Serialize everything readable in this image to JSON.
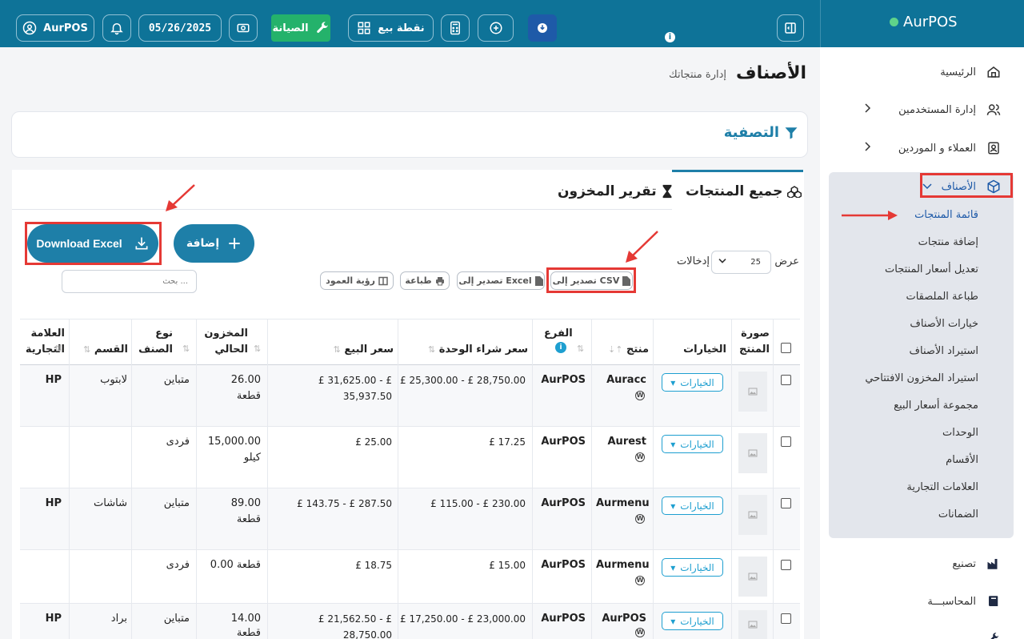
{
  "topbar": {
    "user_label": "AurPOS",
    "date": "05/26/2025",
    "maintenance_label": "الصيانة",
    "pos_label": "نقطة بيع"
  },
  "brand": {
    "name": "AurPOS"
  },
  "sidebar": {
    "items": [
      {
        "label": "الرئيسية",
        "icon": "home-icon"
      },
      {
        "label": "إدارة المستخدمين",
        "icon": "users-icon"
      },
      {
        "label": "العملاء و الموردين",
        "icon": "contacts-icon"
      },
      {
        "label": "الأصناف",
        "icon": "cube-icon"
      },
      {
        "label": "تصنيع",
        "icon": "factory-icon"
      },
      {
        "label": "المحاسبـــة",
        "icon": "book-icon"
      }
    ],
    "sub_items": [
      "قائمة المنتجات",
      "إضافة منتجات",
      "تعديل أسعار المنتجات",
      "طباعة الملصقات",
      "خيارات الأصناف",
      "استيراد الأصناف",
      "استيراد المخزون الافتتاحي",
      "مجموعة أسعار البيع",
      "الوحدات",
      "الأقسام",
      "العلامات التجارية",
      "الضمانات"
    ]
  },
  "page": {
    "title": "الأصناف",
    "subtitle": "إدارة منتجاتك"
  },
  "filter": {
    "label": "التصفية"
  },
  "tabs": {
    "all_products": "جميع المنتجات",
    "stock_report": "تقرير المخزون"
  },
  "actions": {
    "add": "إضافة",
    "download_excel": "Download Excel",
    "export_csv": "تصدير إلى CSV",
    "export_excel": "تصدير إلى Excel",
    "print": "طباعة",
    "column_visibility": "رؤية العمود",
    "search_placeholder": "بحث ...",
    "show": "عرض",
    "entries": "إدخالات",
    "page_size": "25"
  },
  "table": {
    "headers": {
      "image": "صورة المنتج",
      "options": "الخيارات",
      "product": "منتج",
      "branch": "الفرع",
      "purchase_price": "سعر شراء الوحدة",
      "selling_price": "سعر البيع",
      "stock": "المخزون الحالي",
      "type": "نوع الصنف",
      "category": "القسم",
      "brand": "العلامة التجارية"
    },
    "options_button": "الخيارات",
    "rows": [
      {
        "product": "Auracc",
        "branch": "AurPOS",
        "purchase": "£ 25,300.00 - £ 28,750.00",
        "selling": "£ 31,625.00 - £ 35,937.50",
        "stock": "26.00",
        "unit": "قطعة",
        "type": "متباين",
        "category": "لابتوب",
        "brand": "HP"
      },
      {
        "product": "Aurest",
        "branch": "AurPOS",
        "purchase": "£ 17.25",
        "selling": "£ 25.00",
        "stock": "15,000.00",
        "unit": "كيلو",
        "type": "فردى",
        "category": "",
        "brand": ""
      },
      {
        "product": "Aurmenu",
        "branch": "AurPOS",
        "purchase": "£ 115.00 - £ 230.00",
        "selling": "£ 143.75 - £ 287.50",
        "stock": "89.00",
        "unit": "قطعة",
        "type": "متباين",
        "category": "شاشات",
        "brand": "HP"
      },
      {
        "product": "Aurmenu",
        "branch": "AurPOS",
        "purchase": "£ 15.00",
        "selling": "£ 18.75",
        "stock": "0.00 قطعة",
        "unit": "",
        "type": "فردى",
        "category": "",
        "brand": ""
      },
      {
        "product": "AurPOS",
        "branch": "AurPOS",
        "purchase": "£ 17,250.00 - £ 23,000.00",
        "selling": "£ 21,562.50 - £ 28,750.00",
        "stock": "14.00",
        "unit": "قطعة",
        "type": "متباين",
        "category": "براد",
        "brand": "HP"
      }
    ]
  }
}
